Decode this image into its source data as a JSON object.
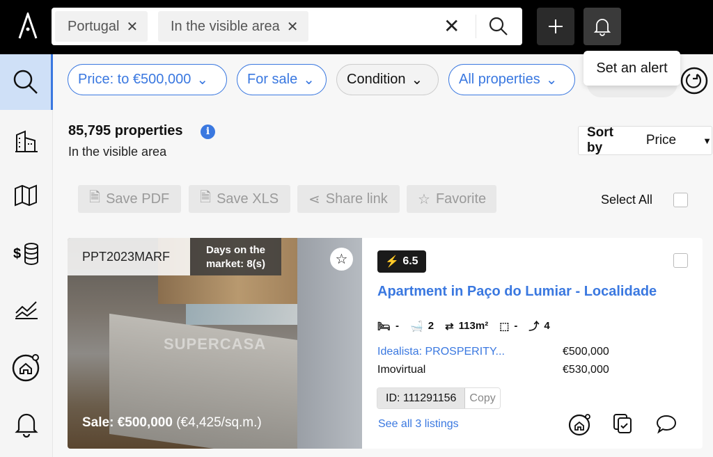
{
  "search": {
    "chips": [
      "Portugal",
      "In the visible area"
    ]
  },
  "filters": [
    "Price: to €500,000",
    "For sale",
    "Condition",
    "All properties"
  ],
  "tooltip": "Set an alert",
  "results": {
    "count": "85,795 properties",
    "area": "In the visible area"
  },
  "sort": {
    "label": "Sort by",
    "value": "Price"
  },
  "actions": [
    "Save PDF",
    "Save XLS",
    "Share link",
    "Favorite"
  ],
  "select_all": "Select All",
  "listing": {
    "code": "PPT2023MARF",
    "days_line1": "Days on the",
    "days_line2": "market: 8(s)",
    "watermark": "SUPERCASA",
    "sale_price": "Sale: €500,000",
    "price_per_sqm": "(€4,425/sq.m.)",
    "score": "6.5",
    "title": "Apartment in Paço do Lumiar - Localidade",
    "features": {
      "bedrooms": "-",
      "bathrooms": "2",
      "area": "113m²",
      "rooms": "-",
      "floor": "4"
    },
    "sources": [
      {
        "name": "Idealista: PROSPERITY...",
        "price": "€500,000"
      },
      {
        "name": "Imovirtual",
        "price": "€530,000"
      }
    ],
    "id": "ID: 111291156",
    "copy": "Copy",
    "see_all": "See all 3 listings"
  },
  "colors": {
    "accent": "#3a78e0",
    "topbar": "#000000"
  }
}
